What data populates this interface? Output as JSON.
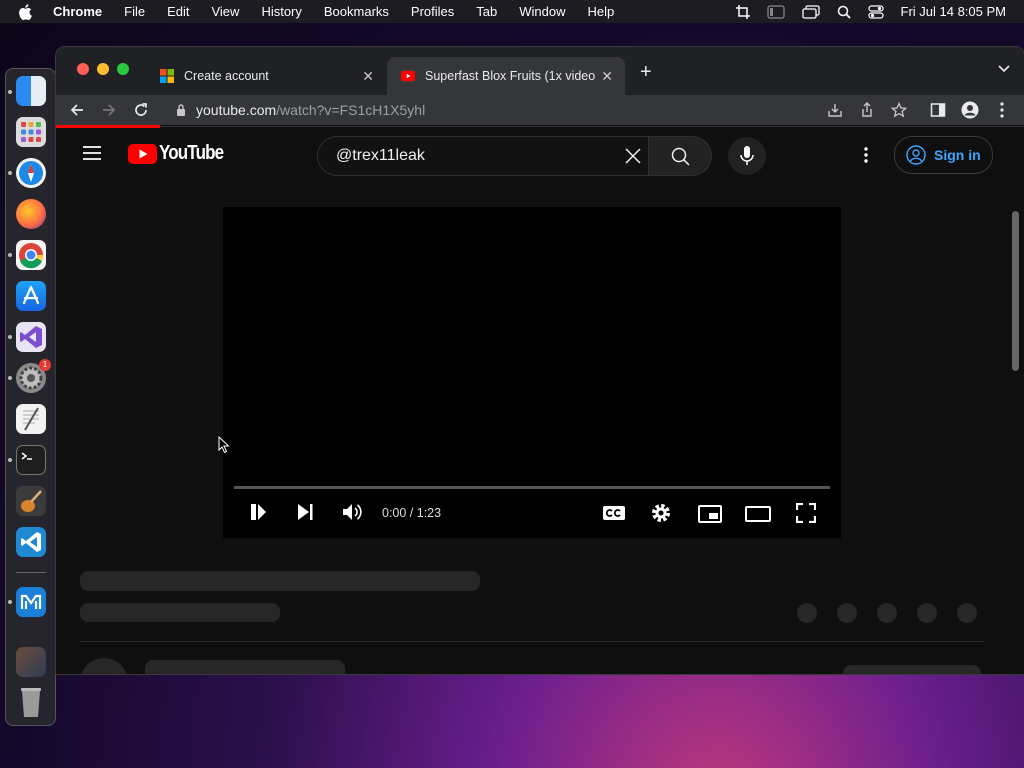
{
  "menubar": {
    "app": "Chrome",
    "items": [
      "File",
      "Edit",
      "View",
      "History",
      "Bookmarks",
      "Profiles",
      "Tab",
      "Window",
      "Help"
    ],
    "clock": "Fri Jul 14  8:05 PM"
  },
  "browser": {
    "tabs": [
      {
        "title": "Create account",
        "close": "✕"
      },
      {
        "title": "Superfast Blox Fruits (1x video",
        "close": "✕"
      }
    ],
    "new_tab": "+",
    "url_host": "youtube.com",
    "url_path": "/watch?v=FS1cH1X5yhl"
  },
  "youtube": {
    "logo_text": "YouTube",
    "search_value": "@trex11leak",
    "sign_in": "Sign in",
    "player": {
      "time": "0:00 / 1:23",
      "progress": 0
    }
  },
  "dock": {
    "badge": "1"
  },
  "colors": {
    "accent_red": "#ff0000",
    "link_blue": "#3ea6ff",
    "yt_bg": "#0f0f0f",
    "tab_active": "#35363a"
  }
}
